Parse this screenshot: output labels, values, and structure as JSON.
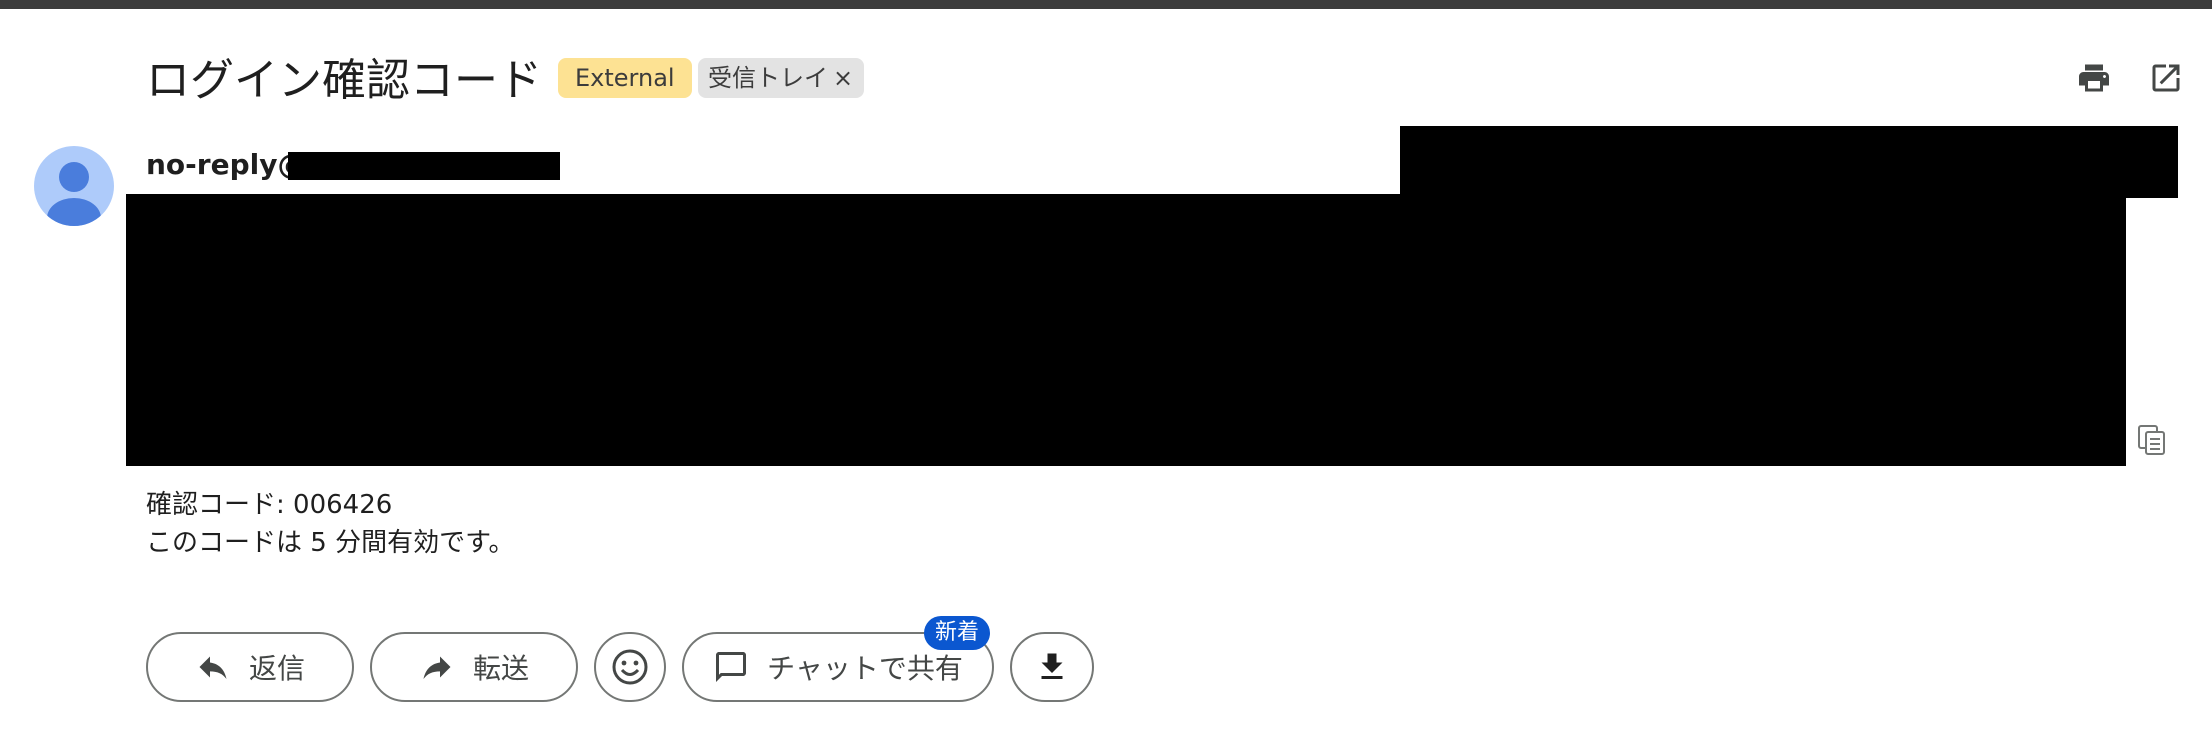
{
  "email": {
    "subject": "ログイン確認コード",
    "labels": {
      "external": "External",
      "inbox": "受信トレイ",
      "inbox_remove": "×"
    },
    "sender": "no-reply@",
    "body_lines": [
      "確認コード: 006426",
      "このコードは 5 分間有効です。"
    ]
  },
  "toolbar": {
    "print_icon": "print-icon",
    "open_new_window_icon": "open-in-new-icon"
  },
  "actions": {
    "reply_label": "返信",
    "forward_label": "転送",
    "share_chat_label": "チャットで共有",
    "new_badge": "新着"
  },
  "colors": {
    "external_chip": "#fde293",
    "label_chip": "#e3e3e3",
    "avatar_bg": "#aecbfa",
    "avatar_fg": "#4a7ddc",
    "badge_bg": "#0b57d0",
    "redaction": "#000000"
  }
}
